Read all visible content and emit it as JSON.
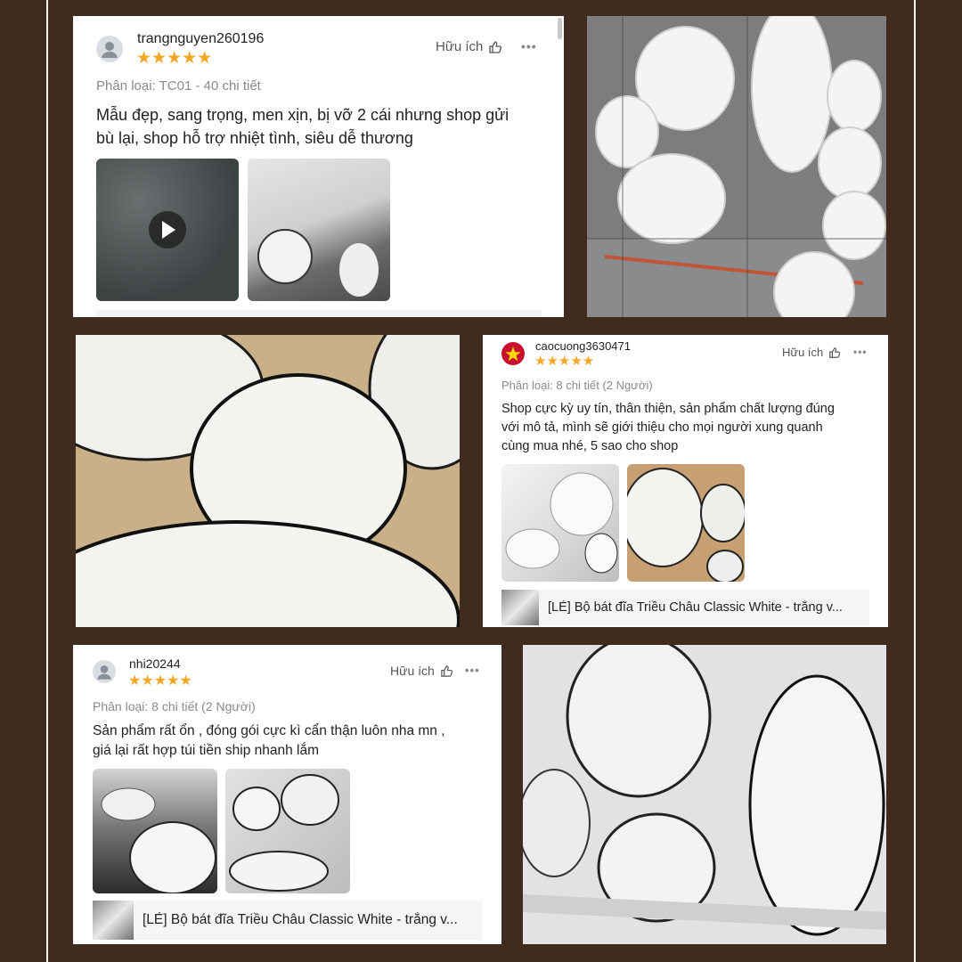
{
  "reviews": [
    {
      "username": "trangnguyen260196",
      "stars": "★★★★★",
      "helpful_label": "Hữu ích",
      "more_label": "•••",
      "meta": "Phân loại: TC01 -  40 chi tiết",
      "text_line1": "Mẫu đẹp, sang trọng, men xịn, bị vỡ 2 cái nhưng shop gửi",
      "text_line2": "bù lại, shop hỗ trợ nhiệt tình, siêu dễ thương"
    },
    {
      "username": "caocuong3630471",
      "stars": "★★★★★",
      "helpful_label": "Hữu ích",
      "more_label": "•••",
      "meta": "Phân loại: 8 chi tiết (2 Người)",
      "text_line1": "Shop cực kỳ uy tín, thân thiện, sản phẩm chất lượng đúng",
      "text_line2": "với mô tả, mình sẽ giới thiệu cho mọi người xung quanh",
      "text_line3": "cùng mua nhé, 5 sao cho shop",
      "product": "[LẺ] Bộ bát đĩa Triều Châu Classic White - trắng v..."
    },
    {
      "username": "nhi20244",
      "stars": "★★★★★",
      "helpful_label": "Hữu ích",
      "more_label": "•••",
      "meta": "Phân loại: 8 chi tiết (2 Người)",
      "text_line1": "Sản phẩm rất ổn , đóng gói cực kì cẩn thận luôn nha mn ,",
      "text_line2": "giá lại rất hợp túi tiền ship nhanh lắm",
      "product": "[LẺ] Bộ bát đĩa Triều Châu Classic White - trắng v..."
    }
  ],
  "colors": {
    "background": "#3f2c1f",
    "star": "#f5a623",
    "frame_line": "#f5f0ea"
  },
  "icons": [
    "user-avatar-icon",
    "thumbs-up-icon",
    "more-options-icon",
    "play-icon",
    "vietnam-flag-icon"
  ]
}
